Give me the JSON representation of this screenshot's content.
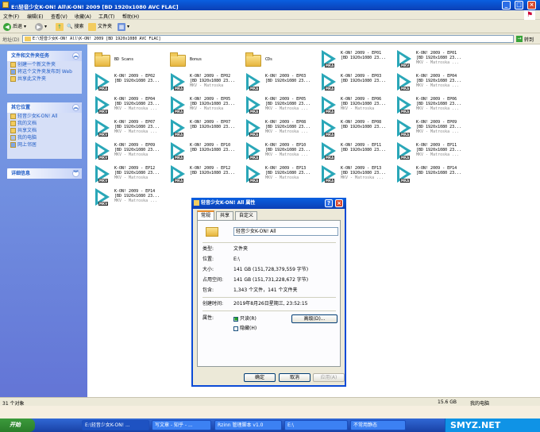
{
  "window": {
    "title": "E:\\轻音少女K-ON! All\\K-ON! 2009 [BD 1920x1080 AVC FLAC]"
  },
  "menu": [
    "文件(F)",
    "编辑(E)",
    "查看(V)",
    "收藏(A)",
    "工具(T)",
    "帮助(H)"
  ],
  "toolbar": {
    "back": "后退",
    "search": "搜索",
    "folders": "文件夹"
  },
  "address": {
    "label": "地址(D)",
    "value": "E:\\轻音少女K-ON! All\\K-ON! 2009 [BD 1920x1080 AVC FLAC]",
    "go": "转到"
  },
  "left_panel": {
    "tasks": {
      "title": "文件和文件夹任务",
      "items": [
        "创建一个新文件夹",
        "将这个文件夹发布到 Web",
        "共享此文件夹"
      ]
    },
    "places": {
      "title": "其它位置",
      "items": [
        "轻音少女K-ON! All",
        "我的文档",
        "共享文档",
        "我的电脑",
        "网上邻居"
      ]
    },
    "details": {
      "title": "详细信息"
    }
  },
  "files": [
    {
      "kind": "folder",
      "name": "BD Scans"
    },
    {
      "kind": "folder",
      "name": "Bonus"
    },
    {
      "kind": "folder",
      "name": "CDs"
    },
    {
      "kind": "mka",
      "l1": "K-ON! 2009 - EP01",
      "l2": "[BD 1920x1080 23..."
    },
    {
      "kind": "mkv",
      "l1": "K-ON! 2009 - EP01",
      "l2": "[BD 1920x1080 23...",
      "l3": "MKV - Matroska ..."
    },
    {
      "kind": "mka",
      "l1": "K-ON! 2009 - EP02",
      "l2": "[BD 1920x1080 23..."
    },
    {
      "kind": "mka",
      "l1": "K-ON! 2009 - EP02",
      "l2": "[BD 1920x1080 23...",
      "l3": "MKV - Matroska"
    },
    {
      "kind": "mka",
      "l1": "K-ON! 2009 - EP03",
      "l2": "[BD 1920x1080 23..."
    },
    {
      "kind": "mka",
      "l1": "K-ON! 2009 - EP03",
      "l2": "[BD 1920x1080 23..."
    },
    {
      "kind": "mka",
      "l1": "K-ON! 2009 - EP04",
      "l2": "[BD 1920x1080 23...",
      "l3": "MKV - Matroska ..."
    },
    {
      "kind": "mkv",
      "l1": "K-ON! 2009 - EP04",
      "l2": "[BD 1920x1080 23...",
      "l3": "MKV - Matroska ..."
    },
    {
      "kind": "mka",
      "l1": "K-ON! 2009 - EP05",
      "l2": "[BD 1920x1080 23...",
      "l3": "MKV - Matroska"
    },
    {
      "kind": "mka",
      "l1": "K-ON! 2009 - EP05",
      "l2": "[BD 1920x1080 23...",
      "l3": "MKV - Matroska ..."
    },
    {
      "kind": "mka",
      "l1": "K-ON! 2009 - EP06",
      "l2": "[BD 1920x1080 23...",
      "l3": "MKV - Matroska"
    },
    {
      "kind": "mka",
      "l1": "K-ON! 2009 - EP06",
      "l2": "[BD 1920x1080 23...",
      "l3": "MKV - Matroska ..."
    },
    {
      "kind": "mkv",
      "l1": "K-ON! 2009 - EP07",
      "l2": "[BD 1920x1080 23...",
      "l3": "MKV - Matroska ..."
    },
    {
      "kind": "mka",
      "l1": "K-ON! 2009 - EP07",
      "l2": "[BD 1920x1080 23..."
    },
    {
      "kind": "mka",
      "l1": "K-ON! 2009 - EP08",
      "l2": "[BD 1920x1080 23...",
      "l3": "MKV - Matroska ..."
    },
    {
      "kind": "mka",
      "l1": "K-ON! 2009 - EP08",
      "l2": "[BD 1920x1080 23..."
    },
    {
      "kind": "mka",
      "l1": "K-ON! 2009 - EP09",
      "l2": "[BD 1920x1080 23...",
      "l3": "MKV - Matroska ..."
    },
    {
      "kind": "mkv",
      "l1": "K-ON! 2009 - EP09",
      "l2": "[BD 1920x1080 23...",
      "l3": "MKV - Matroska"
    },
    {
      "kind": "mka",
      "l1": "K-ON! 2009 - EP10",
      "l2": "[BD 1920x1080 23..."
    },
    {
      "kind": "mka",
      "l1": "K-ON! 2009 - EP10",
      "l2": "[BD 1920x1080 23...",
      "l3": "MKV - Matroska ..."
    },
    {
      "kind": "mka",
      "l1": "K-ON! 2009 - EP11",
      "l2": "[BD 1920x1080 23..."
    },
    {
      "kind": "mka",
      "l1": "K-ON! 2009 - EP11",
      "l2": "[BD 1920x1080 23...",
      "l3": "MKV - Matroska ..."
    },
    {
      "kind": "mkv",
      "l1": "K-ON! 2009 - EP12",
      "l2": "[BD 1920x1080 23...",
      "l3": "MKV - Matroska"
    },
    {
      "kind": "mka",
      "l1": "K-ON! 2009 - EP12",
      "l2": "[BD 1920x1080 23..."
    },
    {
      "kind": "mka",
      "l1": "K-ON! 2009 - EP13",
      "l2": "[BD 1920x1080 23...",
      "l3": "MKV - Matroska"
    },
    {
      "kind": "mka",
      "l1": "K-ON! 2009 - EP13",
      "l2": "[BD 1920x1080 23...",
      "l3": "MKV - Matroska ..."
    },
    {
      "kind": "mka",
      "l1": "K-ON! 2009 - EP14",
      "l2": "[BD 1920x1080 23..."
    },
    {
      "kind": "mkv",
      "l1": "K-ON! 2009 - EP14",
      "l2": "[BD 1920x1080 23...",
      "l3": "MKV - Matroska ..."
    }
  ],
  "statusbar": {
    "count": "31 个对象",
    "size": "15.6 GB",
    "location": "我的电脑"
  },
  "dialog": {
    "title": "轻音少女K-ON! All 属性",
    "tabs": [
      "常规",
      "共享",
      "自定义"
    ],
    "name": "轻音少女K-ON! All",
    "rows": [
      {
        "label": "类型:",
        "value": "文件夹"
      },
      {
        "label": "位置:",
        "value": "E:\\"
      },
      {
        "label": "大小:",
        "value": "141 GB (151,728,379,559 字节)"
      },
      {
        "label": "占用空间:",
        "value": "141 GB (151,731,228,672 字节)"
      },
      {
        "label": "包含:",
        "value": "1,343 个文件，141 个文件夹"
      },
      {
        "label": "创建时间:",
        "value": "2019年8月26日星期三, 23:52:15"
      }
    ],
    "attrs_label": "属性:",
    "readonly": "只读(R)",
    "hidden": "隐藏(H)",
    "advanced": "高级(D)...",
    "ok": "确定",
    "cancel": "取消",
    "apply": "应用(A)"
  },
  "taskbar": {
    "start": "开始",
    "tasks": [
      "E:\\轻音少女K-ON! ...",
      "写文章 - 知乎 - ...",
      "Rzinn 管理脚本 v1.0",
      "E:\\",
      "不常用静态"
    ],
    "watermark": "SMYZ.NET"
  },
  "colors": {
    "accent": "#0b4ad6",
    "mkv_play": "#2aa7b8"
  }
}
